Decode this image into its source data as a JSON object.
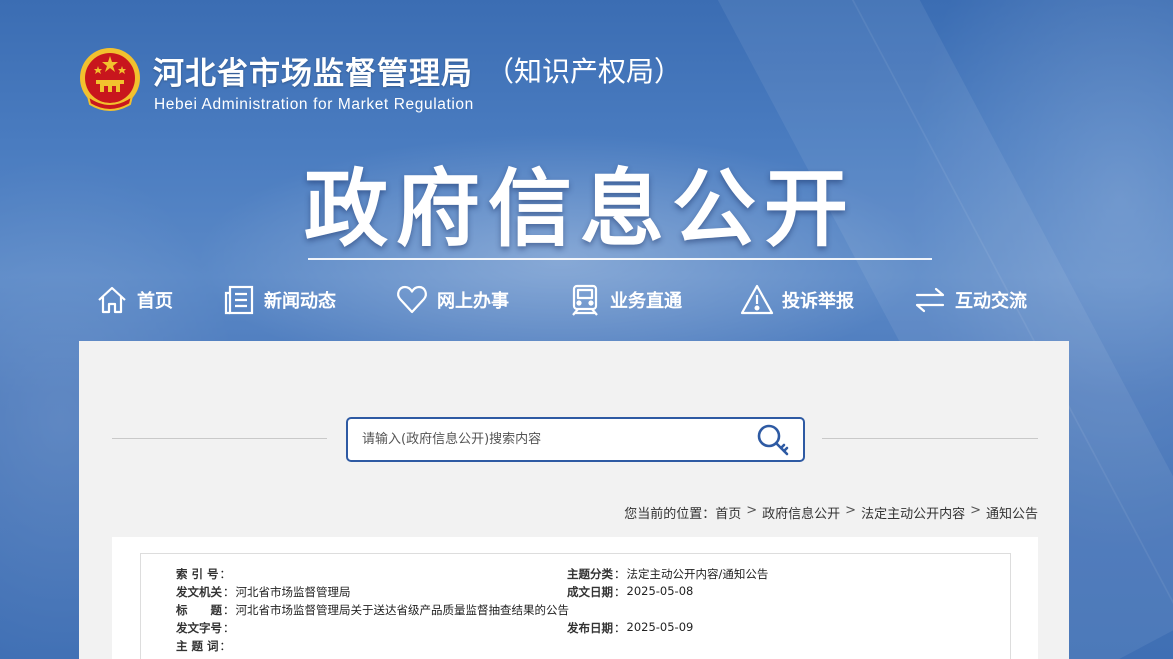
{
  "header": {
    "title_cn": "河北省市场监督管理局",
    "title_cn_suffix": "（知识产权局）",
    "title_en": "Hebei Administration for Market Regulation",
    "emblem": "national-emblem-icon"
  },
  "banner": {
    "title": "政府信息公开"
  },
  "nav": {
    "items": [
      {
        "label": "首页",
        "icon": "home-icon"
      },
      {
        "label": "新闻动态",
        "icon": "news-icon"
      },
      {
        "label": "网上办事",
        "icon": "heart-icon"
      },
      {
        "label": "业务直通",
        "icon": "train-icon"
      },
      {
        "label": "投诉举报",
        "icon": "warning-icon"
      },
      {
        "label": "互动交流",
        "icon": "exchange-icon"
      }
    ]
  },
  "search": {
    "placeholder": "请输入(政府信息公开)搜索内容",
    "icon": "search-icon"
  },
  "breadcrumb": {
    "prefix": "您当前的位置：",
    "items": [
      "首页",
      "政府信息公开",
      "法定主动公开内容",
      "通知公告"
    ],
    "separator": ">"
  },
  "meta": {
    "index_no": {
      "label": "索 引 号",
      "value": ""
    },
    "topic": {
      "label": "主题分类",
      "value": "法定主动公开内容/通知公告"
    },
    "issuer": {
      "label": "发文机关",
      "value": "河北省市场监督管理局"
    },
    "created": {
      "label": "成文日期",
      "value": "2025-05-08"
    },
    "title": {
      "label": "标　　题",
      "value": "河北省市场监督管理局关于送达省级产品质量监督抽查结果的公告"
    },
    "doc_no": {
      "label": "发文字号",
      "value": ""
    },
    "published": {
      "label": "发布日期",
      "value": "2025-05-09"
    },
    "keywords": {
      "label": "主 题 词",
      "value": ""
    }
  },
  "colors": {
    "primary": "#2e5aa3",
    "emblem_red": "#c8161d",
    "emblem_gold": "#f2c12e"
  }
}
